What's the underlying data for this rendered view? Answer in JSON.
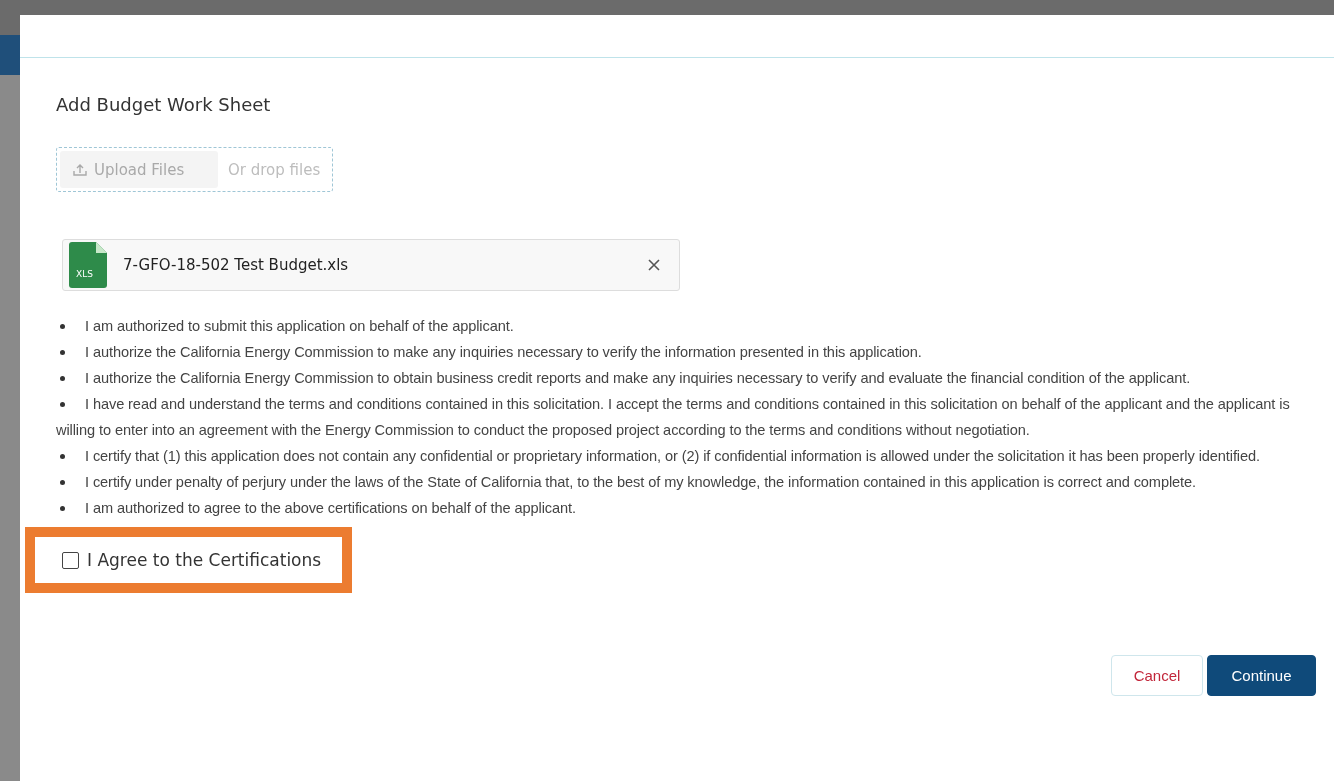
{
  "dialog": {
    "section_title": "Add Budget Work Sheet",
    "upload": {
      "button": "Upload Files",
      "disabled": true,
      "drop_hint": "Or drop files"
    },
    "files": [
      {
        "name": "7-GFO-18-502 Test Budget.xls",
        "badge": "XLS"
      }
    ],
    "certifications": [
      "I am authorized to submit this application on behalf of the applicant.",
      "I authorize the California Energy Commission to make any inquiries necessary to verify the information presented in this application.",
      "I authorize the California Energy Commission to obtain business credit reports and make any inquiries necessary to verify and evaluate the financial condition of the applicant.",
      "I have read and understand the terms and conditions contained in this solicitation. I accept the terms and conditions contained in this solicitation on behalf of the applicant and the applicant is willing to enter into an agreement with the Energy Commission to conduct the proposed project according to the terms and conditions without negotiation.",
      "I certify that (1) this application does not contain any confidential or proprietary information, or (2) if confidential information is allowed under the solicitation it has been properly identified.",
      "I certify under penalty of perjury under the laws of the State of California that, to the best of my knowledge, the information contained in this application is correct and complete.",
      "I am authorized to agree to the above certifications on behalf of the applicant."
    ],
    "agree": {
      "label": "I Agree to the Certifications",
      "checked": false,
      "highlighted": true
    },
    "buttons": [
      {
        "label": "Cancel",
        "kind": "secondary"
      },
      {
        "label": "Continue",
        "kind": "primary"
      }
    ]
  }
}
